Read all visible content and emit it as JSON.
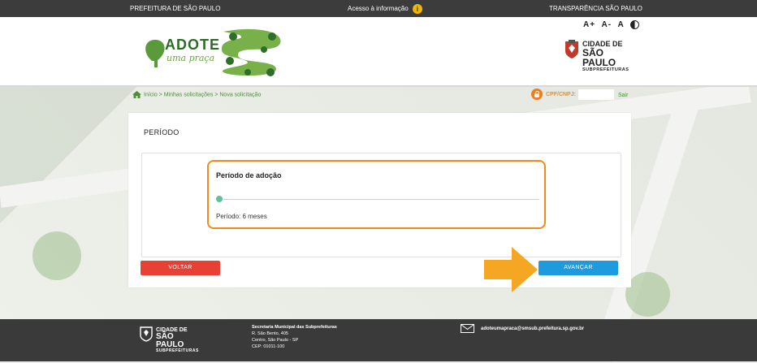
{
  "topbar": {
    "left": "PREFEITURA DE SÃO PAULO",
    "center": "Acesso à informação",
    "right": "TRANSPARÊNCIA SÃO PAULO"
  },
  "header": {
    "logo_line1": "ADOTE",
    "logo_line2": "uma praça",
    "font_controls": [
      "A+",
      "A-",
      "A"
    ],
    "city_line1": "CIDADE DE",
    "city_line2": "SÃO PAULO",
    "city_line3": "SUBPREFEITURAS"
  },
  "breadcrumb": {
    "text": "Início > Minhas solicitações > Nova solicitação",
    "cpf_label": "CPF/CNPJ:",
    "logout": "Sair"
  },
  "card": {
    "title": "PERÍODO",
    "period_label": "Período de adoção",
    "period_value": "Período: 6 meses",
    "slider_fraction": 0.0,
    "back_button": "VOLTAR",
    "next_button": "AVANÇAR"
  },
  "footer": {
    "logo_line1": "CIDADE DE",
    "logo_line2": "SÃO PAULO",
    "logo_line3": "SUBPREFEITURAS",
    "org": "Secretaria Municipal das Subprefeituras",
    "street": "R. São Bento, 405",
    "district": "Centro, São Paulo - SP",
    "cep": "CEP: 01011-100",
    "email": "adoteumapraca@smsub.prefeitura.sp.gov.br"
  },
  "colors": {
    "accent_orange": "#f08a1c",
    "button_red": "#e84035",
    "button_blue": "#1e9adf",
    "brand_green": "#4d8c3b"
  }
}
